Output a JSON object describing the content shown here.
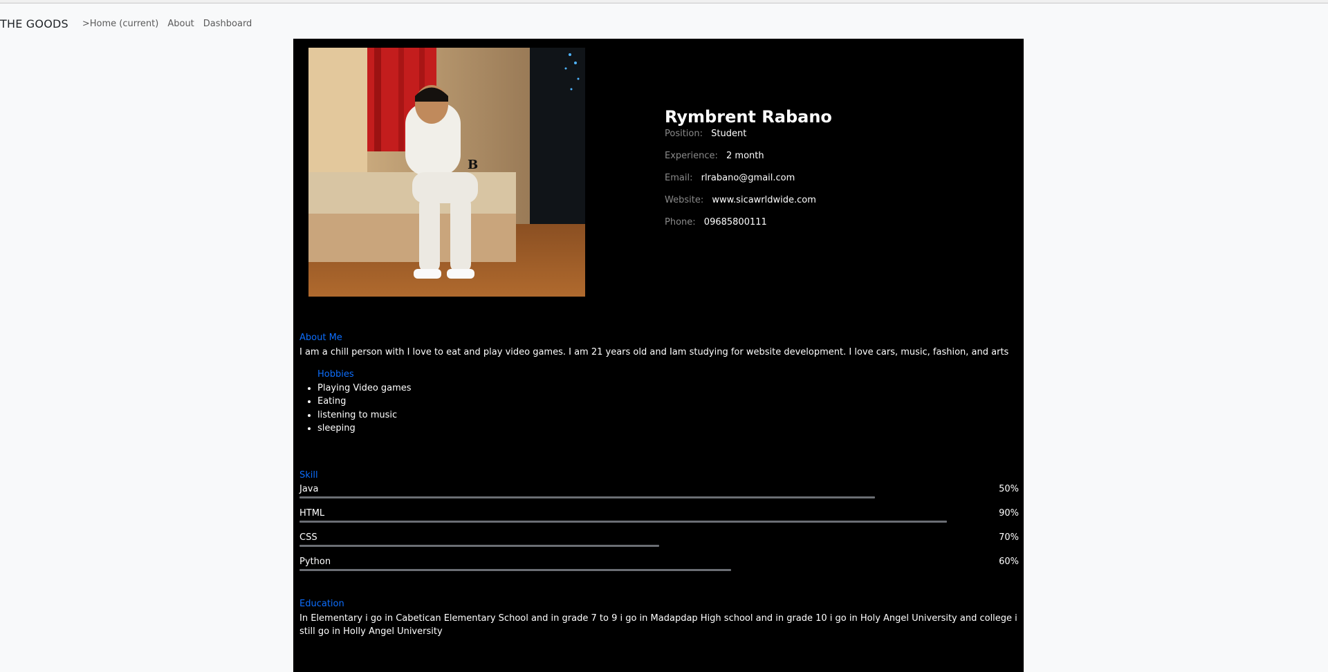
{
  "nav": {
    "brand": "THE GOODS",
    "links": [
      ">Home (current)",
      "About",
      "Dashboard"
    ]
  },
  "profile": {
    "name": "Rymbrent Rabano",
    "fields": [
      {
        "label": "Position:",
        "value": "Student"
      },
      {
        "label": "Experience:",
        "value": "2 month"
      },
      {
        "label": "Email:",
        "value": "rlrabano@gmail.com"
      },
      {
        "label": "Website:",
        "value": "www.sicawrldwide.com"
      },
      {
        "label": "Phone:",
        "value": "09685800111"
      }
    ]
  },
  "about": {
    "title": "About Me",
    "text": "I am a chill person with I love to eat and play video games. I am 21 years old and Iam studying for website development. I love cars, music, fashion, and arts"
  },
  "hobbies": {
    "title": "Hobbies",
    "items": [
      "Playing Video games",
      "Eating",
      "listening to music",
      "sleeping"
    ]
  },
  "skills": {
    "title": "Skill",
    "items": [
      {
        "name": "Java",
        "percent": "50%",
        "fill": 0.8
      },
      {
        "name": "HTML",
        "percent": "90%",
        "fill": 0.9
      },
      {
        "name": "CSS",
        "percent": "70%",
        "fill": 0.5
      },
      {
        "name": "Python",
        "percent": "60%",
        "fill": 0.6
      }
    ]
  },
  "education": {
    "title": "Education",
    "text": "In Elementary i go in Cabetican Elementary School and in grade 7 to 9 i go in Madapdap High school and in grade 10 i go in Holy Angel University and college i still go in Holly Angel University"
  },
  "colors": {
    "accent": "#0d6efd",
    "card_bg": "#000000",
    "page_bg": "#f8f9fa",
    "bar": "#6b6e74"
  }
}
